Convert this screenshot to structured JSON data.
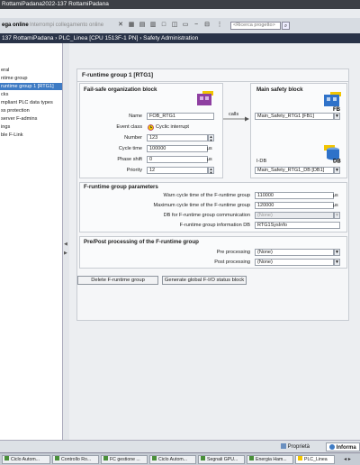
{
  "window": {
    "title": "RottamiPadana2022-137 RottamiPadana"
  },
  "toolbar": {
    "online_label": "ega online",
    "disconnect_label": "Interrompi collegamento online",
    "search_placeholder": "<Ricerca progetto>"
  },
  "breadcrumb": {
    "text": "137 RottamiPadana  ›  PLC_Linea [CPU 1513F-1 PN]  ›  Safety Administration"
  },
  "sidebar": {
    "items": [
      {
        "label": "eral"
      },
      {
        "label": "ntime group"
      },
      {
        "label": "runtime group 1 [RTG1]"
      },
      {
        "label": "cks"
      },
      {
        "label": "mpliant PLC data types"
      },
      {
        "label": "ss protection"
      },
      {
        "label": "server F-admins"
      },
      {
        "label": "ings"
      },
      {
        "label": "ble F-Link"
      }
    ]
  },
  "panel": {
    "title": "F-runtime group 1 [RTG1]",
    "fob": {
      "heading": "Fail-safe organization block",
      "name_label": "Name",
      "name_value": "FOB_RTG1",
      "event_label": "Event class",
      "event_value": "Cyclic interrupt",
      "number_label": "Number",
      "number_value": "123",
      "cycle_label": "Cycle time",
      "cycle_value": "100000",
      "cycle_unit": "μs",
      "phase_label": "Phase shift",
      "phase_value": "0",
      "phase_unit": "μs",
      "priority_label": "Priority",
      "priority_value": "12"
    },
    "calls_label": "calls",
    "msb": {
      "heading": "Main safety block",
      "fb_value": "Main_Safety_RTG1 [FB1]",
      "fb_icon_text": "FB",
      "idb_label": "I-DB",
      "idb_value": "Main_Safety_RTG1_DB [DB1]",
      "db_icon_text": "DB"
    },
    "params": {
      "heading": "F-runtime group parameters",
      "warn_label": "Warn cycle time of the F-runtime group",
      "warn_value": "110000",
      "warn_unit": "μs",
      "max_label": "Maximum cycle time of the F-runtime group",
      "max_value": "120000",
      "max_unit": "μs",
      "comm_label": "DB for F-runtime group communication",
      "comm_value": "(None)",
      "info_label": "F-runtime group information DB",
      "info_value": "RTG1SysInfo"
    },
    "prepost": {
      "heading": "Pre/Post processing of the F-runtime group",
      "pre_label": "Pre processing",
      "pre_value": "(None)",
      "post_label": "Post processing",
      "post_value": "(None)"
    },
    "buttons": {
      "delete": "Delete F-runtime group",
      "generate": "Generate global F-I/O status block"
    }
  },
  "bottom_tabs": {
    "properties": "Proprietà",
    "info": "Informa"
  },
  "taskbar": {
    "items": [
      {
        "label": "Ciclo Autom..."
      },
      {
        "label": "Controllo Ro..."
      },
      {
        "label": "FC gestione ..."
      },
      {
        "label": "Ciclo Autom..."
      },
      {
        "label": "Segnali GPU..."
      },
      {
        "label": "Energia Ham..."
      },
      {
        "label": "PLC_Linea"
      }
    ]
  },
  "colors": {
    "selection": "#3e7bc4",
    "breadcrumb_bg": "#293348",
    "block_icon_purple": "#8e3fa1",
    "block_icon_blue": "#2f72c9",
    "accent_yellow": "#f2c500"
  }
}
